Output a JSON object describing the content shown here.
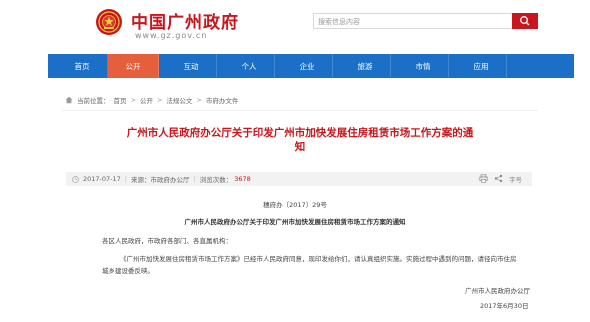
{
  "header": {
    "site_title": "中国广州政府",
    "site_url": "www.gz.gov.cn",
    "search": {
      "placeholder": "搜索信息内容"
    }
  },
  "nav": {
    "items": [
      "首页",
      "公开",
      "互动",
      "个人",
      "企业",
      "旅游",
      "市情",
      "应用"
    ],
    "active_index": 1
  },
  "breadcrumb": {
    "prefix": "当前位置：",
    "items": [
      "首页",
      "公开",
      "法规公文",
      "市府办文件"
    ],
    "separator": ">"
  },
  "article": {
    "title": "广州市人民政府办公厅关于印发广州市加快发展住房租赁市场工作方案的通知",
    "meta": {
      "date": "2017-07-17",
      "source": "来源：市政府办公厅",
      "views_label": "浏览次数：",
      "views": "3678",
      "font_size_label": "字号"
    },
    "doc_number": "穗府办〔2017〕29号",
    "heading": "广州市人民政府办公厅关于印发广州市加快发展住房租赁市场工作方案的通知",
    "recipients": "各区人民政府，市政府各部门、各直属机构：",
    "body_line1": "《广州市加快发展住房租赁市场工作方案》已经市人民政府同意，现印发给你们，请认真组织实施。实施过程中遇到的问题，请径向市住房",
    "body_line2": "城乡建设委反映。",
    "signature": "广州市人民政府办公厅",
    "sign_date": "2017年6月30日"
  },
  "colors": {
    "brand_red": "#c8161d",
    "nav_blue": "#1c6fc6",
    "nav_active": "#e55f3c"
  }
}
